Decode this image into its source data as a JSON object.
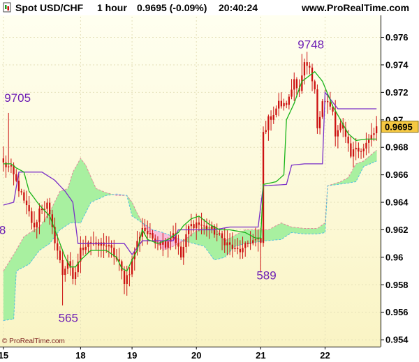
{
  "header": {
    "instrument": "Spot USD/CHF",
    "timeframe": "1 hour",
    "quote": "0.9695 (-0.09%)",
    "time": "20:40:24",
    "site": "www.ProRealTime.com"
  },
  "copyright": "© ProRealTime.com",
  "colors": {
    "background_top": "#fffff0",
    "background_bottom": "#faf4c4",
    "candle": "#cc1111",
    "kijun": "#7a2fc8",
    "tenkan": "#18b418",
    "cloud_bullish": "#a8f0a0",
    "cloud_bearish": "#f8c0dc",
    "senkou_a_line": "#e08a9a",
    "senkou_b_line": "#50c0e0",
    "price_badge": "#f5c842",
    "annotation": "#6e1fb4"
  },
  "chart_data": {
    "type": "candlestick",
    "title": "Spot USD/CHF 1 hour",
    "last_price": "0.9695",
    "last_price_value": 0.9695,
    "ylim": [
      0.9536,
      0.9775
    ],
    "y_ticks": [
      "0.976",
      "0.974",
      "0.972",
      "0.97",
      "0.968",
      "0.966",
      "0.964",
      "0.962",
      "0.96",
      "0.958",
      "0.956",
      "0.954"
    ],
    "y_tick_values": [
      0.976,
      0.974,
      0.972,
      0.97,
      0.968,
      0.966,
      0.964,
      0.962,
      0.96,
      0.958,
      0.956,
      0.954
    ],
    "x_ticks": [
      "15",
      "18",
      "19",
      "20",
      "21",
      "22"
    ],
    "x_tick_index": [
      0,
      30,
      50,
      75,
      100,
      125
    ],
    "n_bars": 146,
    "annotations": [
      {
        "text": "9705",
        "bar": 2,
        "value": 0.9713
      },
      {
        "text": "8",
        "bar": 0,
        "value": 0.9617
      },
      {
        "text": "565",
        "bar": 23,
        "value": 0.9553
      },
      {
        "text": "589",
        "bar": 100,
        "value": 0.9584
      },
      {
        "text": "9748",
        "bar": 116,
        "value": 0.9752
      }
    ],
    "close_anchors": [
      [
        0,
        0.9668
      ],
      [
        3,
        0.9664
      ],
      [
        6,
        0.965
      ],
      [
        8,
        0.964
      ],
      [
        10,
        0.9632
      ],
      [
        12,
        0.962
      ],
      [
        14,
        0.9635
      ],
      [
        17,
        0.9638
      ],
      [
        19,
        0.962
      ],
      [
        21,
        0.9605
      ],
      [
        23,
        0.9588
      ],
      [
        25,
        0.9598
      ],
      [
        27,
        0.9582
      ],
      [
        30,
        0.9605
      ],
      [
        33,
        0.9612
      ],
      [
        36,
        0.9608
      ],
      [
        39,
        0.961
      ],
      [
        42,
        0.9605
      ],
      [
        45,
        0.9595
      ],
      [
        47,
        0.9583
      ],
      [
        49,
        0.959
      ],
      [
        51,
        0.9605
      ],
      [
        54,
        0.9622
      ],
      [
        57,
        0.9615
      ],
      [
        60,
        0.9612
      ],
      [
        63,
        0.961
      ],
      [
        66,
        0.9618
      ],
      [
        69,
        0.96
      ],
      [
        72,
        0.9622
      ],
      [
        75,
        0.9625
      ],
      [
        78,
        0.9622
      ],
      [
        81,
        0.962
      ],
      [
        84,
        0.9615
      ],
      [
        87,
        0.961
      ],
      [
        90,
        0.9605
      ],
      [
        93,
        0.9605
      ],
      [
        96,
        0.9612
      ],
      [
        99,
        0.9612
      ],
      [
        100,
        0.961
      ],
      [
        101,
        0.969
      ],
      [
        103,
        0.97
      ],
      [
        105,
        0.9705
      ],
      [
        107,
        0.9712
      ],
      [
        109,
        0.971
      ],
      [
        111,
        0.9715
      ],
      [
        113,
        0.973
      ],
      [
        115,
        0.9722
      ],
      [
        117,
        0.974
      ],
      [
        119,
        0.9735
      ],
      [
        121,
        0.972
      ],
      [
        122,
        0.9695
      ],
      [
        124,
        0.9715
      ],
      [
        126,
        0.9712
      ],
      [
        128,
        0.9705
      ],
      [
        129,
        0.9688
      ],
      [
        131,
        0.9695
      ],
      [
        133,
        0.969
      ],
      [
        135,
        0.9675
      ],
      [
        137,
        0.968
      ],
      [
        139,
        0.9676
      ],
      [
        141,
        0.9684
      ],
      [
        143,
        0.969
      ],
      [
        145,
        0.9695
      ]
    ],
    "high_points": [
      [
        2,
        0.9705
      ],
      [
        116,
        0.9748
      ]
    ],
    "low_points": [
      [
        23,
        0.9565
      ],
      [
        100,
        0.9589
      ]
    ],
    "series": [
      {
        "name": "kijun",
        "points": [
          [
            0,
            0.9638
          ],
          [
            4,
            0.964
          ],
          [
            6,
            0.9662
          ],
          [
            15,
            0.9662
          ],
          [
            20,
            0.9656
          ],
          [
            24,
            0.9648
          ],
          [
            27,
            0.964
          ],
          [
            29,
            0.961
          ],
          [
            40,
            0.961
          ],
          [
            47,
            0.961
          ],
          [
            50,
            0.9602
          ],
          [
            54,
            0.9612
          ],
          [
            66,
            0.9612
          ],
          [
            68,
            0.962
          ],
          [
            82,
            0.962
          ],
          [
            88,
            0.9622
          ],
          [
            99,
            0.9622
          ],
          [
            101,
            0.9652
          ],
          [
            110,
            0.9653
          ],
          [
            112,
            0.9667
          ],
          [
            117,
            0.9668
          ],
          [
            124,
            0.9668
          ],
          [
            125,
            0.972
          ],
          [
            130,
            0.9708
          ],
          [
            145,
            0.9708
          ]
        ]
      },
      {
        "name": "tenkan",
        "points": [
          [
            0,
            0.9668
          ],
          [
            3,
            0.9668
          ],
          [
            5,
            0.9665
          ],
          [
            8,
            0.9662
          ],
          [
            10,
            0.9648
          ],
          [
            14,
            0.9638
          ],
          [
            18,
            0.963
          ],
          [
            20,
            0.962
          ],
          [
            22,
            0.961
          ],
          [
            24,
            0.96
          ],
          [
            26,
            0.9593
          ],
          [
            28,
            0.9593
          ],
          [
            30,
            0.9598
          ],
          [
            34,
            0.9605
          ],
          [
            40,
            0.9605
          ],
          [
            44,
            0.96
          ],
          [
            46,
            0.9592
          ],
          [
            48,
            0.959
          ],
          [
            50,
            0.9598
          ],
          [
            52,
            0.9605
          ],
          [
            54,
            0.962
          ],
          [
            56,
            0.9613
          ],
          [
            60,
            0.961
          ],
          [
            64,
            0.9613
          ],
          [
            68,
            0.9618
          ],
          [
            70,
            0.9623
          ],
          [
            73,
            0.9628
          ],
          [
            76,
            0.963
          ],
          [
            80,
            0.9624
          ],
          [
            84,
            0.962
          ],
          [
            88,
            0.962
          ],
          [
            94,
            0.9618
          ],
          [
            98,
            0.9614
          ],
          [
            100,
            0.9614
          ],
          [
            101,
            0.9653
          ],
          [
            106,
            0.9655
          ],
          [
            109,
            0.966
          ],
          [
            110,
            0.97
          ],
          [
            113,
            0.9712
          ],
          [
            116,
            0.9728
          ],
          [
            121,
            0.9735
          ],
          [
            124,
            0.9728
          ],
          [
            128,
            0.971
          ],
          [
            131,
            0.97
          ],
          [
            134,
            0.969
          ],
          [
            137,
            0.9685
          ],
          [
            141,
            0.9686
          ],
          [
            145,
            0.9686
          ]
        ]
      },
      {
        "name": "senkou_a",
        "points": [
          [
            0,
            0.959
          ],
          [
            4,
            0.9602
          ],
          [
            8,
            0.9615
          ],
          [
            12,
            0.962
          ],
          [
            14,
            0.9622
          ],
          [
            18,
            0.9633
          ],
          [
            22,
            0.9648
          ],
          [
            25,
            0.965
          ],
          [
            27,
            0.9662
          ],
          [
            30,
            0.9672
          ],
          [
            32,
            0.9667
          ],
          [
            36,
            0.965
          ],
          [
            40,
            0.9647
          ],
          [
            44,
            0.9645
          ],
          [
            48,
            0.9645
          ],
          [
            50,
            0.964
          ],
          [
            52,
            0.9632
          ],
          [
            55,
            0.9622
          ],
          [
            59,
            0.9613
          ],
          [
            62,
            0.9605
          ],
          [
            66,
            0.9608
          ],
          [
            70,
            0.9612
          ],
          [
            74,
            0.9618
          ],
          [
            78,
            0.9622
          ],
          [
            82,
            0.9622
          ],
          [
            86,
            0.9612
          ],
          [
            90,
            0.9616
          ],
          [
            94,
            0.962
          ],
          [
            98,
            0.962
          ],
          [
            103,
            0.962
          ],
          [
            108,
            0.9625
          ],
          [
            112,
            0.9622
          ],
          [
            117,
            0.9621
          ],
          [
            122,
            0.9621
          ],
          [
            125,
            0.9625
          ],
          [
            126,
            0.9652
          ],
          [
            131,
            0.9655
          ],
          [
            134,
            0.9658
          ],
          [
            137,
            0.9668
          ],
          [
            140,
            0.967
          ],
          [
            145,
            0.9678
          ]
        ]
      },
      {
        "name": "senkou_b",
        "points": [
          [
            0,
            0.9554
          ],
          [
            4,
            0.9555
          ],
          [
            5,
            0.959
          ],
          [
            10,
            0.9595
          ],
          [
            14,
            0.9605
          ],
          [
            18,
            0.961
          ],
          [
            22,
            0.962
          ],
          [
            26,
            0.9625
          ],
          [
            30,
            0.9625
          ],
          [
            34,
            0.964
          ],
          [
            40,
            0.9645
          ],
          [
            44,
            0.9646
          ],
          [
            48,
            0.9645
          ],
          [
            50,
            0.963
          ],
          [
            54,
            0.9625
          ],
          [
            58,
            0.962
          ],
          [
            62,
            0.9618
          ],
          [
            66,
            0.9615
          ],
          [
            70,
            0.9612
          ],
          [
            74,
            0.961
          ],
          [
            78,
            0.9608
          ],
          [
            82,
            0.9598
          ],
          [
            86,
            0.96
          ],
          [
            90,
            0.9608
          ],
          [
            94,
            0.961
          ],
          [
            98,
            0.9611
          ],
          [
            102,
            0.9612
          ],
          [
            108,
            0.9613
          ],
          [
            112,
            0.9618
          ],
          [
            117,
            0.9617
          ],
          [
            122,
            0.9617
          ],
          [
            125,
            0.9618
          ],
          [
            126,
            0.9652
          ],
          [
            134,
            0.9654
          ],
          [
            137,
            0.9655
          ],
          [
            140,
            0.9666
          ],
          [
            145,
            0.967
          ]
        ]
      }
    ]
  }
}
